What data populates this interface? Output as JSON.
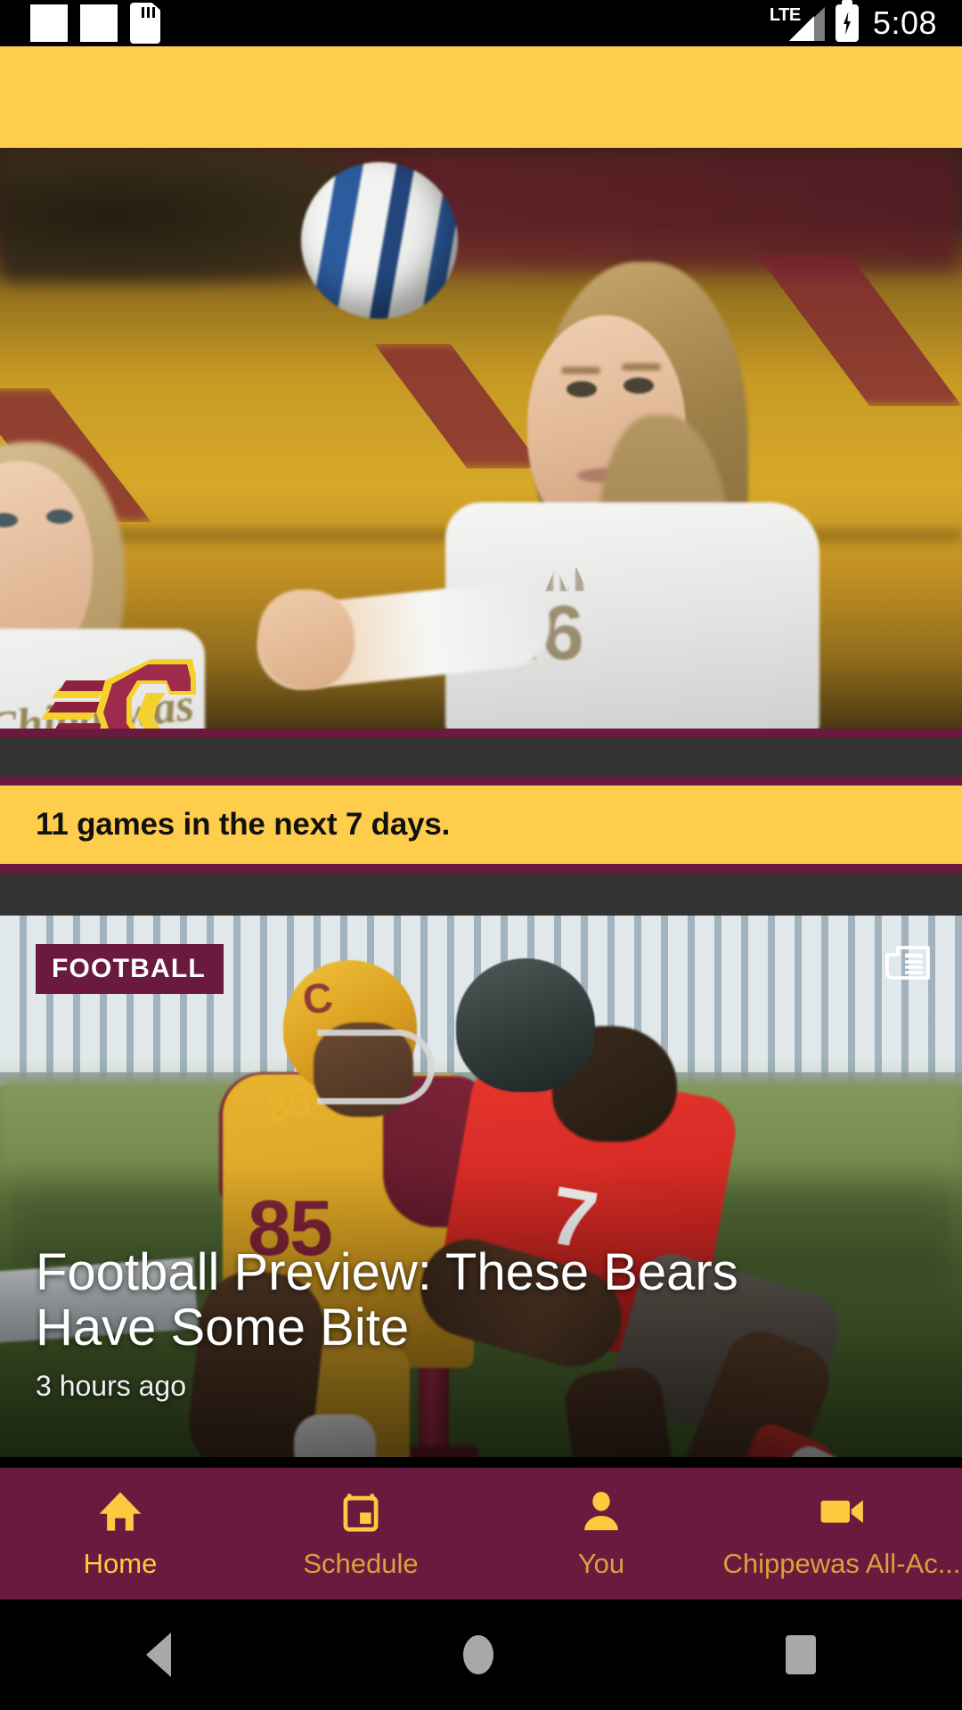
{
  "status_bar": {
    "icons": [
      "notification-square-icon",
      "notification-square-icon",
      "sd-card-icon"
    ],
    "network_label": "LTE",
    "battery": "battery-charging-icon",
    "time": "5:08"
  },
  "top_bar": {
    "label": "",
    "background_color": "#FECD4B"
  },
  "hero": {
    "alt": "Volleyball player bumping a ball in the gym",
    "logo_name": "cmu-flying-c-logo",
    "jersey_number": "16",
    "team_script": "Chippewas"
  },
  "games_banner": {
    "text": "11 games in the next 7 days.",
    "background_color": "#FECD4B",
    "text_color": "#111111"
  },
  "article": {
    "category": "FOOTBALL",
    "headline": "Football Preview: These Bears Have Some Bite",
    "timestamp": "3 hours ago",
    "action_icon": "newspaper-icon",
    "photo_alt": "CMU receiver number 85 being tackled by defender number 7",
    "home_player_number": "85",
    "away_player_number": "7"
  },
  "bottom_nav": {
    "background_color": "#6B1A3F",
    "active_color": "#FFC93F",
    "inactive_color": "#D9A13C",
    "items": [
      {
        "label": "Home",
        "icon": "home-icon",
        "active": true
      },
      {
        "label": "Schedule",
        "icon": "calendar-icon",
        "active": false
      },
      {
        "label": "You",
        "icon": "person-icon",
        "active": false
      },
      {
        "label": "Chippewas All-Ac...",
        "icon": "video-camera-icon",
        "active": false
      }
    ]
  },
  "android_nav": {
    "back": "back-triangle-icon",
    "home": "home-circle-icon",
    "recents": "recents-square-icon"
  }
}
